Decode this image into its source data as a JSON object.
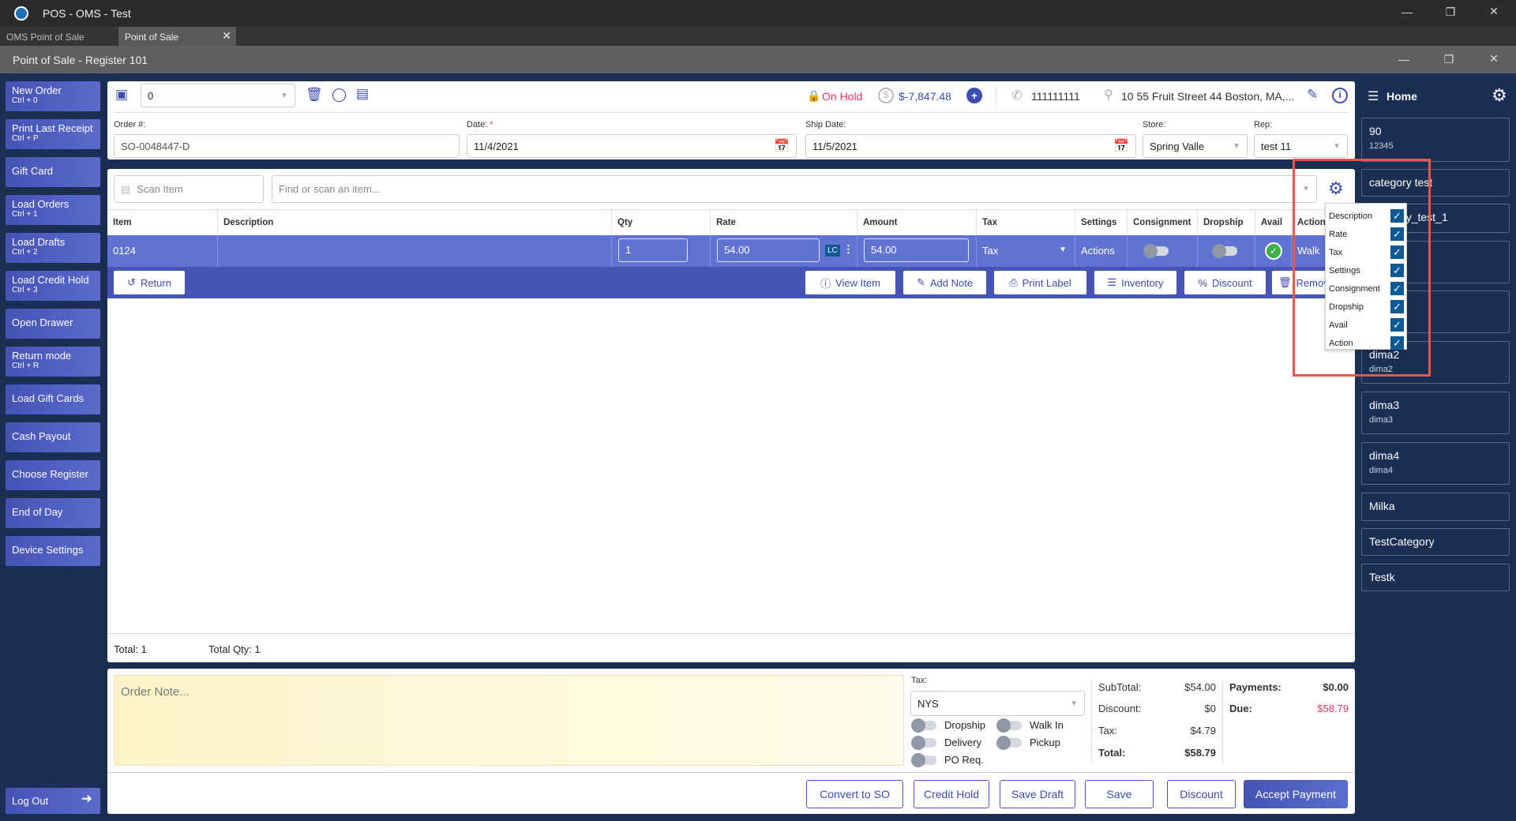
{
  "window": {
    "title": "POS - OMS - Test",
    "tabs": [
      {
        "label": "OMS Point of Sale"
      },
      {
        "label": "Point of Sale"
      }
    ],
    "header": "Point of Sale - Register 101"
  },
  "sidebar": {
    "items": [
      {
        "label": "New Order",
        "shortcut": "Ctrl + 0"
      },
      {
        "label": "Print Last Receipt",
        "shortcut": "Ctrl + P"
      },
      {
        "label": "Gift Card"
      },
      {
        "label": "Load Orders",
        "shortcut": "Ctrl + 1"
      },
      {
        "label": "Load Drafts",
        "shortcut": "Ctrl + 2"
      },
      {
        "label": "Load Credit Hold",
        "shortcut": "Ctrl + 3"
      },
      {
        "label": "Open Drawer"
      },
      {
        "label": "Return mode",
        "shortcut": "Ctrl + R"
      },
      {
        "label": "Load Gift Cards"
      },
      {
        "label": "Cash Payout"
      },
      {
        "label": "Choose Register"
      },
      {
        "label": "End of Day"
      },
      {
        "label": "Device Settings"
      }
    ],
    "logout": "Log Out"
  },
  "customer": {
    "value": "0",
    "status": "On Hold",
    "balance": "$-7,847.48",
    "phone": "111111111",
    "address": "10 55 Fruit Street 44 Boston, MA,..."
  },
  "order": {
    "order_label": "Order #:",
    "order_no": "SO-0048447-D",
    "date_label": "Date:",
    "required": "*",
    "date": "11/4/2021",
    "ship_label": "Ship Date:",
    "ship_date": "11/5/2021",
    "store_label": "Store:",
    "store": "Spring Valle",
    "rep_label": "Rep:",
    "rep": "test 11"
  },
  "search": {
    "scan_placeholder": "Scan Item",
    "find_placeholder": "Find or scan an item..."
  },
  "table": {
    "columns": [
      "Item",
      "Description",
      "Qty",
      "Rate",
      "Amount",
      "Tax",
      "Settings",
      "Consignment",
      "Dropship",
      "Avail",
      "Action"
    ],
    "row": {
      "item": "0124",
      "description": "",
      "qty": "1",
      "rate": "54.00",
      "lc": "LC",
      "amount": "54.00",
      "tax": "Tax",
      "settings": "Actions",
      "action": "Walk"
    },
    "row_actions": {
      "return": "Return",
      "view": "View Item",
      "note": "Add Note",
      "print": "Print Label",
      "inventory": "Inventory",
      "discount": "Discount",
      "remove": "Remove"
    }
  },
  "column_menu": [
    {
      "label": "Description",
      "checked": true
    },
    {
      "label": "Rate",
      "checked": true
    },
    {
      "label": "Tax",
      "checked": true
    },
    {
      "label": "Settings",
      "checked": true
    },
    {
      "label": "Consignment",
      "checked": true
    },
    {
      "label": "Dropship",
      "checked": true
    },
    {
      "label": "Avail",
      "checked": true
    },
    {
      "label": "Action",
      "checked": true
    }
  ],
  "totals": {
    "total": "Total: 1",
    "qty": "Total Qty: 1"
  },
  "footer": {
    "note_placeholder": "Order Note...",
    "tax_label": "Tax:",
    "tax": "NYS",
    "toggles": {
      "dropship": "Dropship",
      "walkin": "Walk In",
      "delivery": "Delivery",
      "pickup": "Pickup",
      "po": "PO Req."
    },
    "subtotal_label": "SubTotal:",
    "subtotal": "$54.00",
    "discount_label": "Discount:",
    "discount": "$0",
    "tax_amt_label": "Tax:",
    "tax_amt": "$4.79",
    "total_label": "Total:",
    "total": "$58.79",
    "payments_label": "Payments:",
    "payments": "$0.00",
    "due_label": "Due:",
    "due": "$58.79",
    "buttons": {
      "convert": "Convert to SO",
      "credit": "Credit Hold",
      "draft": "Save Draft",
      "save": "Save",
      "discount": "Discount",
      "accept": "Accept Payment"
    }
  },
  "right": {
    "home": "Home",
    "items": [
      {
        "title": "90",
        "sub": "12345"
      },
      {
        "title": "category test"
      },
      {
        "title": "category_test_1"
      },
      {
        "title": ""
      },
      {
        "title": ""
      },
      {
        "title": "dima2",
        "sub": "dima2"
      },
      {
        "title": "dima3",
        "sub": "dima3"
      },
      {
        "title": "dima4",
        "sub": "dima4"
      },
      {
        "title": "Milka"
      },
      {
        "title": "TestCategory"
      },
      {
        "title": "Testk"
      }
    ]
  },
  "colors": {
    "navy": "#1b2f54",
    "accent": "#4a57b8",
    "due": "#e8365d",
    "highlight": "#e8584a"
  }
}
